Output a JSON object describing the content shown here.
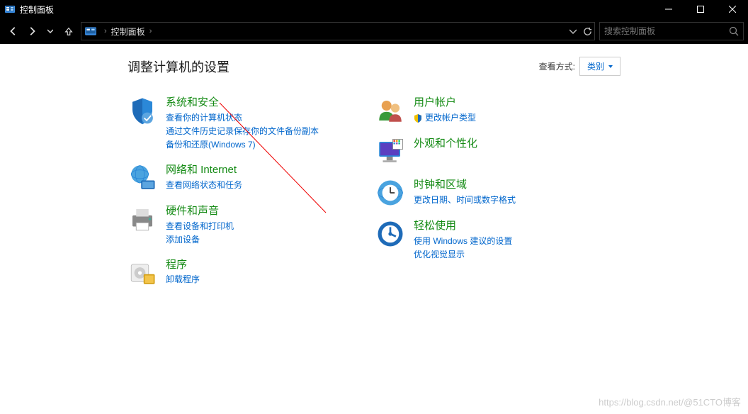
{
  "window": {
    "title": "控制面板"
  },
  "nav": {
    "breadcrumb": "控制面板",
    "search_placeholder": "搜索控制面板"
  },
  "header": {
    "title": "调整计算机的设置",
    "view_label": "查看方式:",
    "view_value": "类别"
  },
  "left_col": [
    {
      "title": "系统和安全",
      "links": [
        "查看你的计算机状态",
        "通过文件历史记录保存你的文件备份副本",
        "备份和还原(Windows 7)"
      ],
      "icon": "shield"
    },
    {
      "title": "网络和 Internet",
      "links": [
        "查看网络状态和任务"
      ],
      "icon": "network"
    },
    {
      "title": "硬件和声音",
      "links": [
        "查看设备和打印机",
        "添加设备"
      ],
      "icon": "printer"
    },
    {
      "title": "程序",
      "links": [
        "卸载程序"
      ],
      "icon": "programs"
    }
  ],
  "right_col": [
    {
      "title": "用户帐户",
      "links": [
        "更改帐户类型"
      ],
      "shield_link": true,
      "icon": "users"
    },
    {
      "title": "外观和个性化",
      "links": [],
      "icon": "appearance"
    },
    {
      "title": "时钟和区域",
      "links": [
        "更改日期、时间或数字格式"
      ],
      "icon": "clock"
    },
    {
      "title": "轻松使用",
      "links": [
        "使用 Windows 建议的设置",
        "优化视觉显示"
      ],
      "icon": "ease"
    }
  ],
  "watermark": "https://blog.csdn.net/@51CTO博客"
}
